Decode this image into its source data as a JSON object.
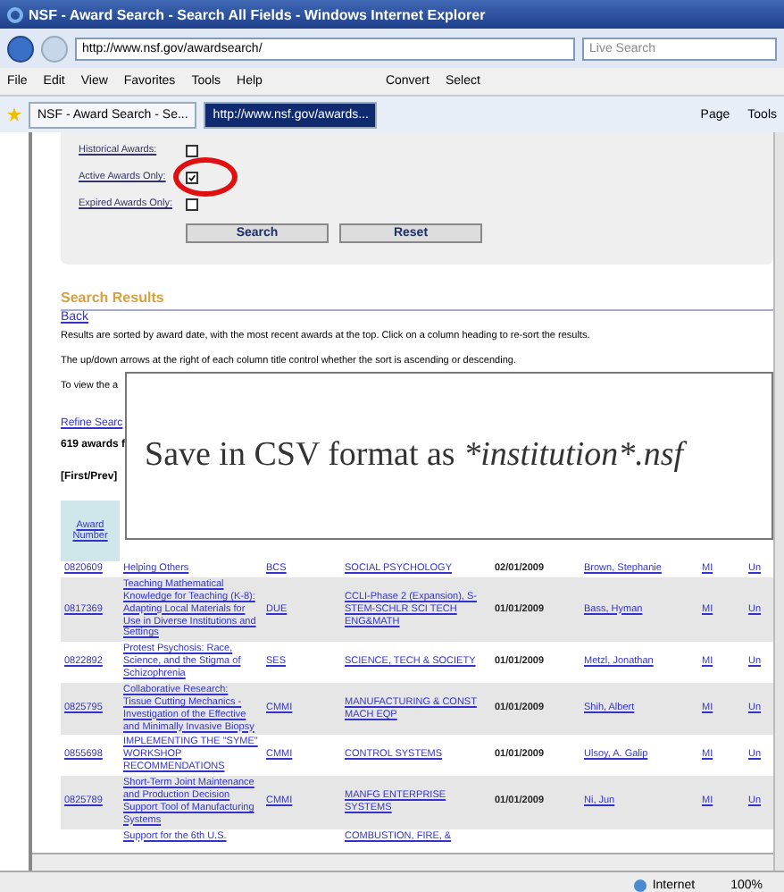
{
  "window": {
    "title": "NSF - Award Search - Search All Fields - Windows Internet Explorer"
  },
  "address_bar": {
    "url": "http://www.nsf.gov/awardsearch/",
    "search_placeholder": "Live Search"
  },
  "menu": [
    "File",
    "Edit",
    "View",
    "Favorites",
    "Tools",
    "Help"
  ],
  "menu_tools": [
    "Convert",
    "Select"
  ],
  "tabs": [
    {
      "label": "NSF - Award Search - Se...",
      "selected": false
    },
    {
      "label": "http://www.nsf.gov/awards...",
      "selected": true
    }
  ],
  "command_bar": [
    "Page",
    "Tools"
  ],
  "search_form": {
    "checkboxes": [
      {
        "label": "Historical Awards:",
        "checked": false
      },
      {
        "label": "Active Awards Only:",
        "checked": true
      },
      {
        "label": "Expired Awards Only:",
        "checked": false
      }
    ],
    "buttons": [
      "Search",
      "Reset"
    ]
  },
  "results": {
    "heading": "Search Results",
    "back_link": "Back",
    "notes": [
      "Results are sorted by award date, with the most recent awards at the top. Click on a column heading to re-sort the results.",
      "The up/down arrows at the right of each column title control whether the sort is ascending or descending.",
      "To view the a"
    ],
    "refine_link": "Refine Searc",
    "count": "619 awards f",
    "pager": "[First/Prev]",
    "columns": [
      "Award Number"
    ],
    "rows": [
      {
        "number": "0820609",
        "title": "Helping Others",
        "org": "BCS",
        "program": "SOCIAL PSYCHOLOGY",
        "date": "02/01/2009",
        "pi": "Brown, Stephanie",
        "state": "MI",
        "institution": "Un"
      },
      {
        "number": "0817369",
        "title": "Teaching Mathematical Knowledge for Teaching (K-8): Adapting Local Materials for Use in Diverse Institutions and Settings",
        "org": "DUE",
        "program": "CCLI-Phase 2 (Expansion), S-STEM-SCHLR SCI TECH ENG&MATH",
        "date": "01/01/2009",
        "pi": "Bass, Hyman",
        "state": "MI",
        "institution": "Un"
      },
      {
        "number": "0822892",
        "title": "Protest Psychosis: Race, Science, and the Stigma of Schizophrenia",
        "org": "SES",
        "program": "SCIENCE, TECH & SOCIETY",
        "date": "01/01/2009",
        "pi": "Metzl, Jonathan",
        "state": "MI",
        "institution": "Un"
      },
      {
        "number": "0825795",
        "title": "Collaborative Research: Tissue Cutting Mechanics - Investigation of the Effective and Minimally Invasive Biopsy",
        "org": "CMMI",
        "program": "MANUFACTURING & CONST MACH EQP",
        "date": "01/01/2009",
        "pi": "Shih, Albert",
        "state": "MI",
        "institution": "Un"
      },
      {
        "number": "0855698",
        "title": "IMPLEMENTING THE \"SYME\" WORKSHOP RECOMMENDATIONS",
        "org": "CMMI",
        "program": "CONTROL SYSTEMS",
        "date": "01/01/2009",
        "pi": "Ulsoy, A. Galip",
        "state": "MI",
        "institution": "Un"
      },
      {
        "number": "0825789",
        "title": "Short-Term Joint Maintenance and Production Decision Support Tool of Manufacturing Systems",
        "org": "CMMI",
        "program": "MANFG ENTERPRISE SYSTEMS",
        "date": "01/01/2009",
        "pi": "Ni, Jun",
        "state": "MI",
        "institution": "Un"
      },
      {
        "title": "Support for the 6th U.S.",
        "program": "COMBUSTION, FIRE, &"
      }
    ]
  },
  "callout": {
    "text": "Save in CSV format as",
    "emphasis": "*institution*.nsf"
  },
  "status_bar": {
    "zone": "Internet",
    "zoom": "100%"
  }
}
